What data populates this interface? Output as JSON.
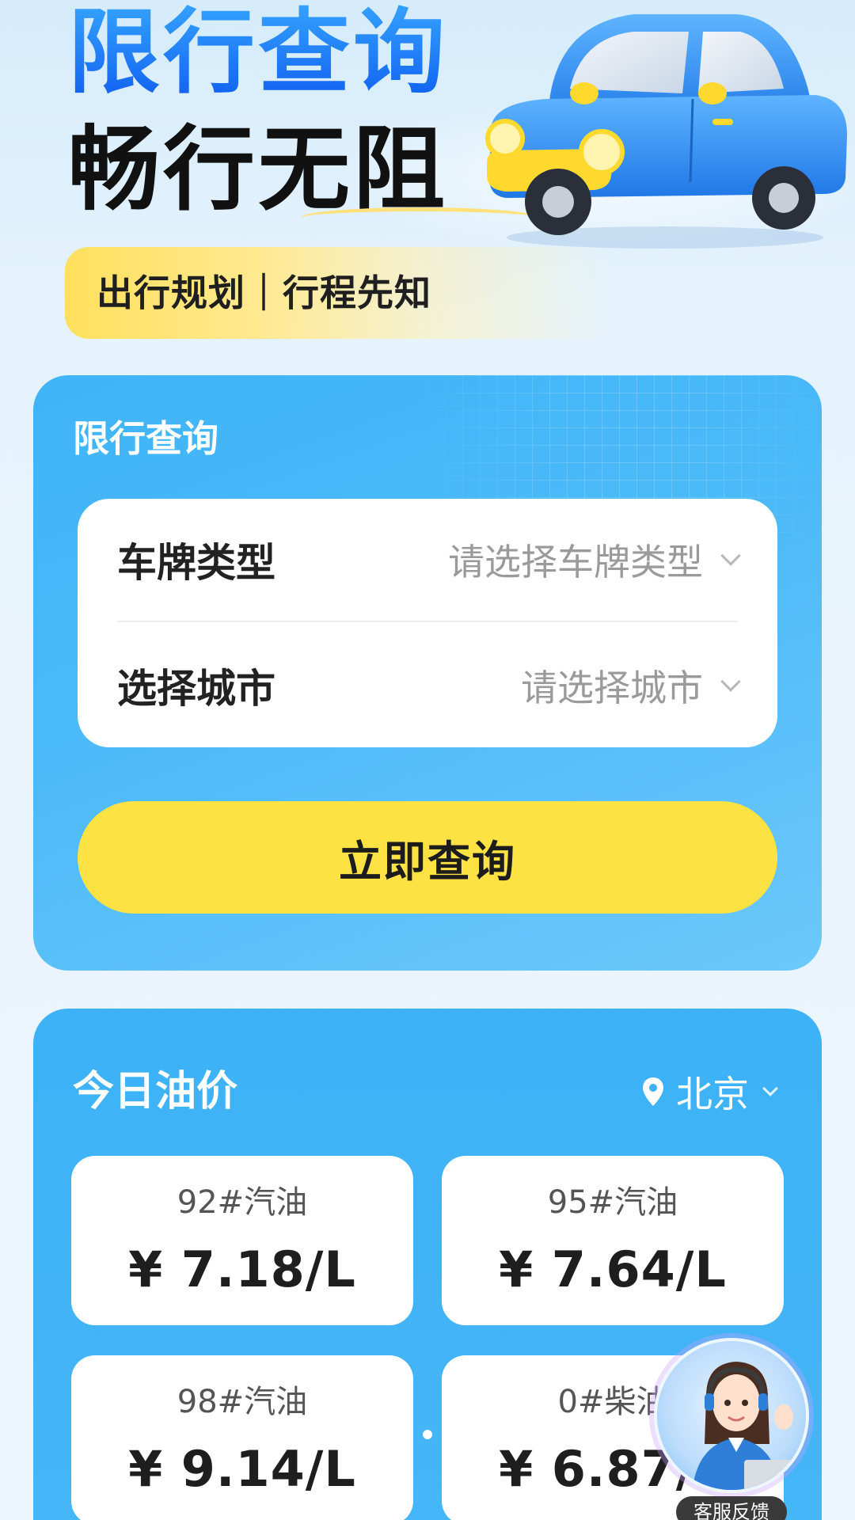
{
  "hero": {
    "title_line1": "限行查询",
    "title_line2": "畅行无阻",
    "tagline": "出行规划｜行程先知"
  },
  "query": {
    "title": "限行查询",
    "plate": {
      "label": "车牌类型",
      "placeholder": "请选择车牌类型"
    },
    "city": {
      "label": "选择城市",
      "placeholder": "请选择城市"
    },
    "button": "立即查询"
  },
  "oil": {
    "title": "今日油价",
    "city": "北京",
    "prices": [
      {
        "type": "92#汽油",
        "price": "¥ 7.18/L"
      },
      {
        "type": "95#汽油",
        "price": "¥ 7.64/L"
      },
      {
        "type": "98#汽油",
        "price": "¥ 9.14/L"
      },
      {
        "type": "0#柴油",
        "price": "¥ 6.87/L"
      }
    ]
  },
  "service": {
    "label": "客服反馈"
  },
  "colors": {
    "accent_blue": "#3fb4f7",
    "button_yellow": "#fde244",
    "title_blue": "#1a6ef5"
  }
}
